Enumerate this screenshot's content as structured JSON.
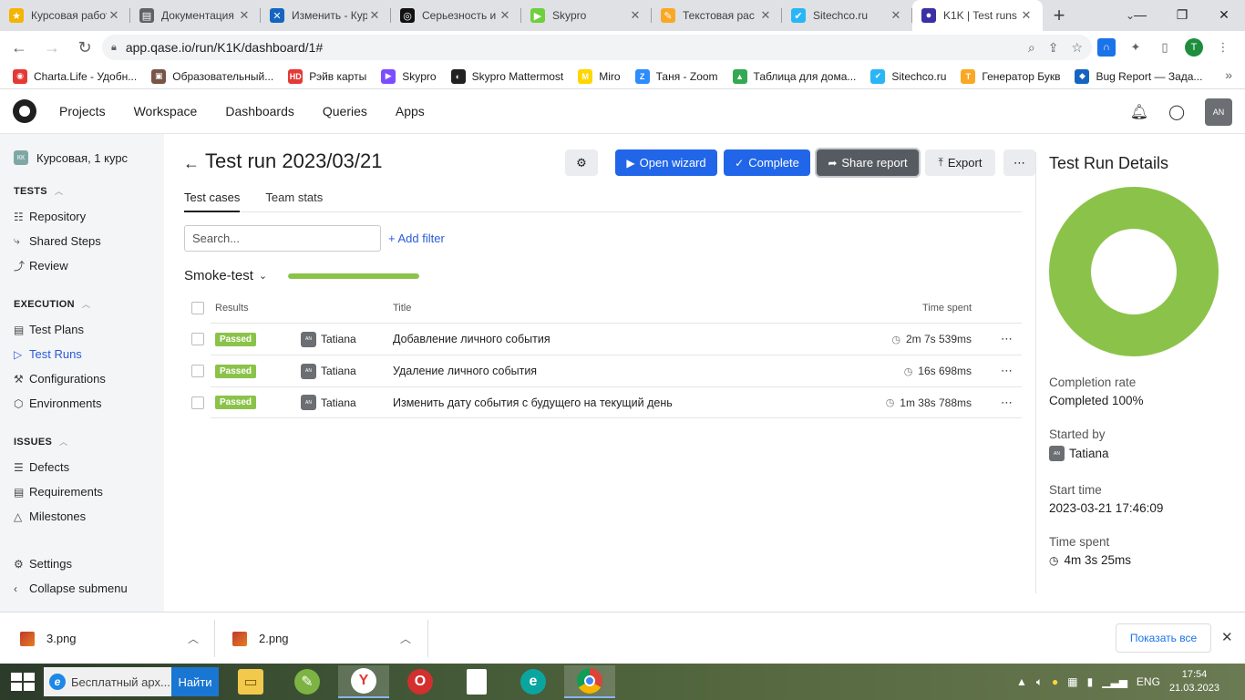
{
  "browser": {
    "tabs": [
      {
        "title": "Курсовая работа",
        "fav_color": "#f4b400",
        "fav_glyph": "★"
      },
      {
        "title": "Документация",
        "fav_color": "#5f6368",
        "fav_glyph": "▤"
      },
      {
        "title": "Изменить - Курс",
        "fav_color": "#1565c0",
        "fav_glyph": "✕"
      },
      {
        "title": "Серьезность и",
        "fav_color": "#111111",
        "fav_glyph": "◎"
      },
      {
        "title": "Skypro",
        "fav_color": "#6fcf3c",
        "fav_glyph": "▶"
      },
      {
        "title": "Текстовая рас",
        "fav_color": "#f9a825",
        "fav_glyph": "✎"
      },
      {
        "title": "Sitechco.ru",
        "fav_color": "#29b6f6",
        "fav_glyph": "✔"
      },
      {
        "title": "K1K | Test runs",
        "fav_color": "#3d2fa6",
        "fav_glyph": "●",
        "active": true
      }
    ],
    "url": "app.qase.io/run/K1K/dashboard/1#",
    "profile_initial": "T",
    "bookmarks": [
      {
        "label": "Charta.Life - Удобн...",
        "color": "#e53935",
        "glyph": "◉"
      },
      {
        "label": "Образовательный...",
        "color": "#795548",
        "glyph": "▣"
      },
      {
        "label": "Рэйв карты",
        "color": "#e53935",
        "glyph": "HD"
      },
      {
        "label": "Skypro",
        "color": "#7c4dff",
        "glyph": "▶"
      },
      {
        "label": "Skypro Mattermost",
        "color": "#222222",
        "glyph": "◐"
      },
      {
        "label": "Miro",
        "color": "#ffd600",
        "glyph": "M"
      },
      {
        "label": "Таня - Zoom",
        "color": "#2d8cff",
        "glyph": "Z"
      },
      {
        "label": "Таблица для дома...",
        "color": "#34a853",
        "glyph": "▲"
      },
      {
        "label": "Sitechco.ru",
        "color": "#29b6f6",
        "glyph": "✔"
      },
      {
        "label": "Генератор Букв",
        "color": "#f9a825",
        "glyph": "T"
      },
      {
        "label": "Bug Report — Зада...",
        "color": "#1565c0",
        "glyph": "◆"
      }
    ]
  },
  "app": {
    "nav": [
      "Projects",
      "Workspace",
      "Dashboards",
      "Queries",
      "Apps"
    ],
    "user_initials": "AN"
  },
  "sidebar": {
    "project_initials": "КК",
    "project_name": "Курсовая, 1 курс",
    "tests_title": "TESTS",
    "tests_items": [
      {
        "label": "Repository",
        "icon": "list-icon",
        "glyph": "☷"
      },
      {
        "label": "Shared Steps",
        "icon": "share-steps-icon",
        "glyph": "⤷"
      },
      {
        "label": "Review",
        "icon": "review-icon",
        "glyph": "⤴"
      }
    ],
    "execution_title": "EXECUTION",
    "execution_items": [
      {
        "label": "Test Plans",
        "icon": "plan-icon",
        "glyph": "▤"
      },
      {
        "label": "Test Runs",
        "icon": "play-icon",
        "glyph": "▷",
        "active": true
      },
      {
        "label": "Configurations",
        "icon": "wrench-icon",
        "glyph": "⚒"
      },
      {
        "label": "Environments",
        "icon": "cube-icon",
        "glyph": "⬡"
      }
    ],
    "issues_title": "ISSUES",
    "issues_items": [
      {
        "label": "Defects",
        "icon": "defect-icon",
        "glyph": "☰"
      },
      {
        "label": "Requirements",
        "icon": "doc-icon",
        "glyph": "▤"
      },
      {
        "label": "Milestones",
        "icon": "milestone-icon",
        "glyph": "△"
      }
    ],
    "settings": "Settings",
    "collapse": "Collapse submenu"
  },
  "main": {
    "title": "Test run 2023/03/21",
    "btn_wizard": "Open wizard",
    "btn_complete": "Complete",
    "btn_share": "Share report",
    "btn_export": "Export",
    "tabs": [
      "Test cases",
      "Team stats"
    ],
    "search_placeholder": "Search...",
    "add_filter": "+ Add filter",
    "suite_name": "Smoke-test",
    "suite_progress": 1.0,
    "columns": {
      "results": "Results",
      "title": "Title",
      "time": "Time spent"
    },
    "rows": [
      {
        "status": "Passed",
        "assignee": "Tatiana",
        "assignee_initials": "AN",
        "title": "Добавление личного события",
        "time": "2m 7s 539ms"
      },
      {
        "status": "Passed",
        "assignee": "Tatiana",
        "assignee_initials": "AN",
        "title": "Удаление личного события",
        "time": "16s 698ms"
      },
      {
        "status": "Passed",
        "assignee": "Tatiana",
        "assignee_initials": "AN",
        "title": "Изменить дату события с будущего на текущий день",
        "time": "1m 38s 788ms"
      }
    ],
    "colors": {
      "passed": "#8bc34a",
      "primary": "#2166e8"
    }
  },
  "details": {
    "title": "Test Run Details",
    "completion_label": "Completion rate",
    "completion_value": "Completed 100%",
    "completion_fraction": 1.0,
    "started_by_label": "Started by",
    "started_by": "Tatiana",
    "started_by_initials": "AN",
    "start_time_label": "Start time",
    "start_time": "2023-03-21 17:46:09",
    "time_spent_label": "Time spent",
    "time_spent": "4m 3s 25ms"
  },
  "downloads": {
    "files": [
      "3.png",
      "2.png"
    ],
    "show_all": "Показать все"
  },
  "taskbar": {
    "search_text": "Бесплатный арх...",
    "find_button": "Найти",
    "lang": "ENG",
    "time": "17:54",
    "date": "21.03.2023"
  }
}
